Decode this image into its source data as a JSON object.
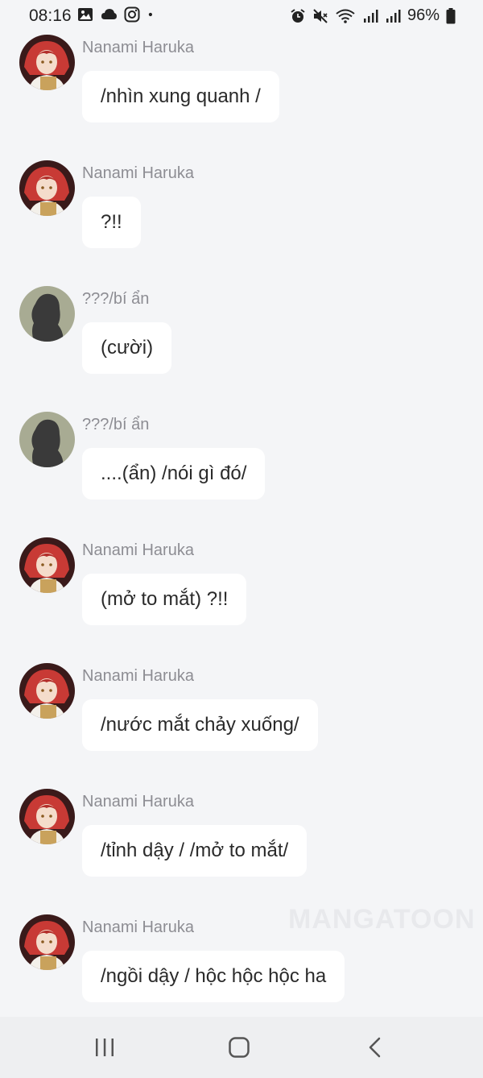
{
  "status_bar": {
    "time": "08:16",
    "battery": "96%",
    "left_icons": [
      "gallery-icon",
      "cloud-icon",
      "instagram-icon",
      "dot-icon"
    ],
    "right_icons": [
      "alarm-icon",
      "mute-icon",
      "wifi-icon",
      "signal-icon",
      "signal-icon",
      "battery-icon"
    ]
  },
  "messages": [
    {
      "speaker": "Nanami Haruka",
      "text": "/nhìn xung quanh /",
      "avatar": "nanami"
    },
    {
      "speaker": "Nanami Haruka",
      "text": "?!!",
      "avatar": "nanami"
    },
    {
      "speaker": "???/bí ẩn",
      "text": "(cười)",
      "avatar": "silhouette"
    },
    {
      "speaker": "???/bí ẩn",
      "text": "....(ẩn) /nói gì đó/",
      "avatar": "silhouette"
    },
    {
      "speaker": "Nanami Haruka",
      "text": "(mở to mắt) ?!!",
      "avatar": "nanami"
    },
    {
      "speaker": "Nanami Haruka",
      "text": "/nước mắt chảy xuống/",
      "avatar": "nanami"
    },
    {
      "speaker": "Nanami Haruka",
      "text": "/tỉnh dậy / /mở to mắt/",
      "avatar": "nanami"
    },
    {
      "speaker": "Nanami Haruka",
      "text": "/ngồi dậy / hộc hộc hộc ha",
      "avatar": "nanami"
    }
  ],
  "watermark": "MANGATOON",
  "nav_bar": {
    "buttons": [
      "recent-apps-icon",
      "home-icon",
      "back-icon"
    ]
  },
  "colors": {
    "background": "#f4f5f7",
    "bubble": "#ffffff",
    "speaker_text": "#8d8d93",
    "message_text": "#2a2a2a",
    "nav_bar": "#eeeff1"
  }
}
